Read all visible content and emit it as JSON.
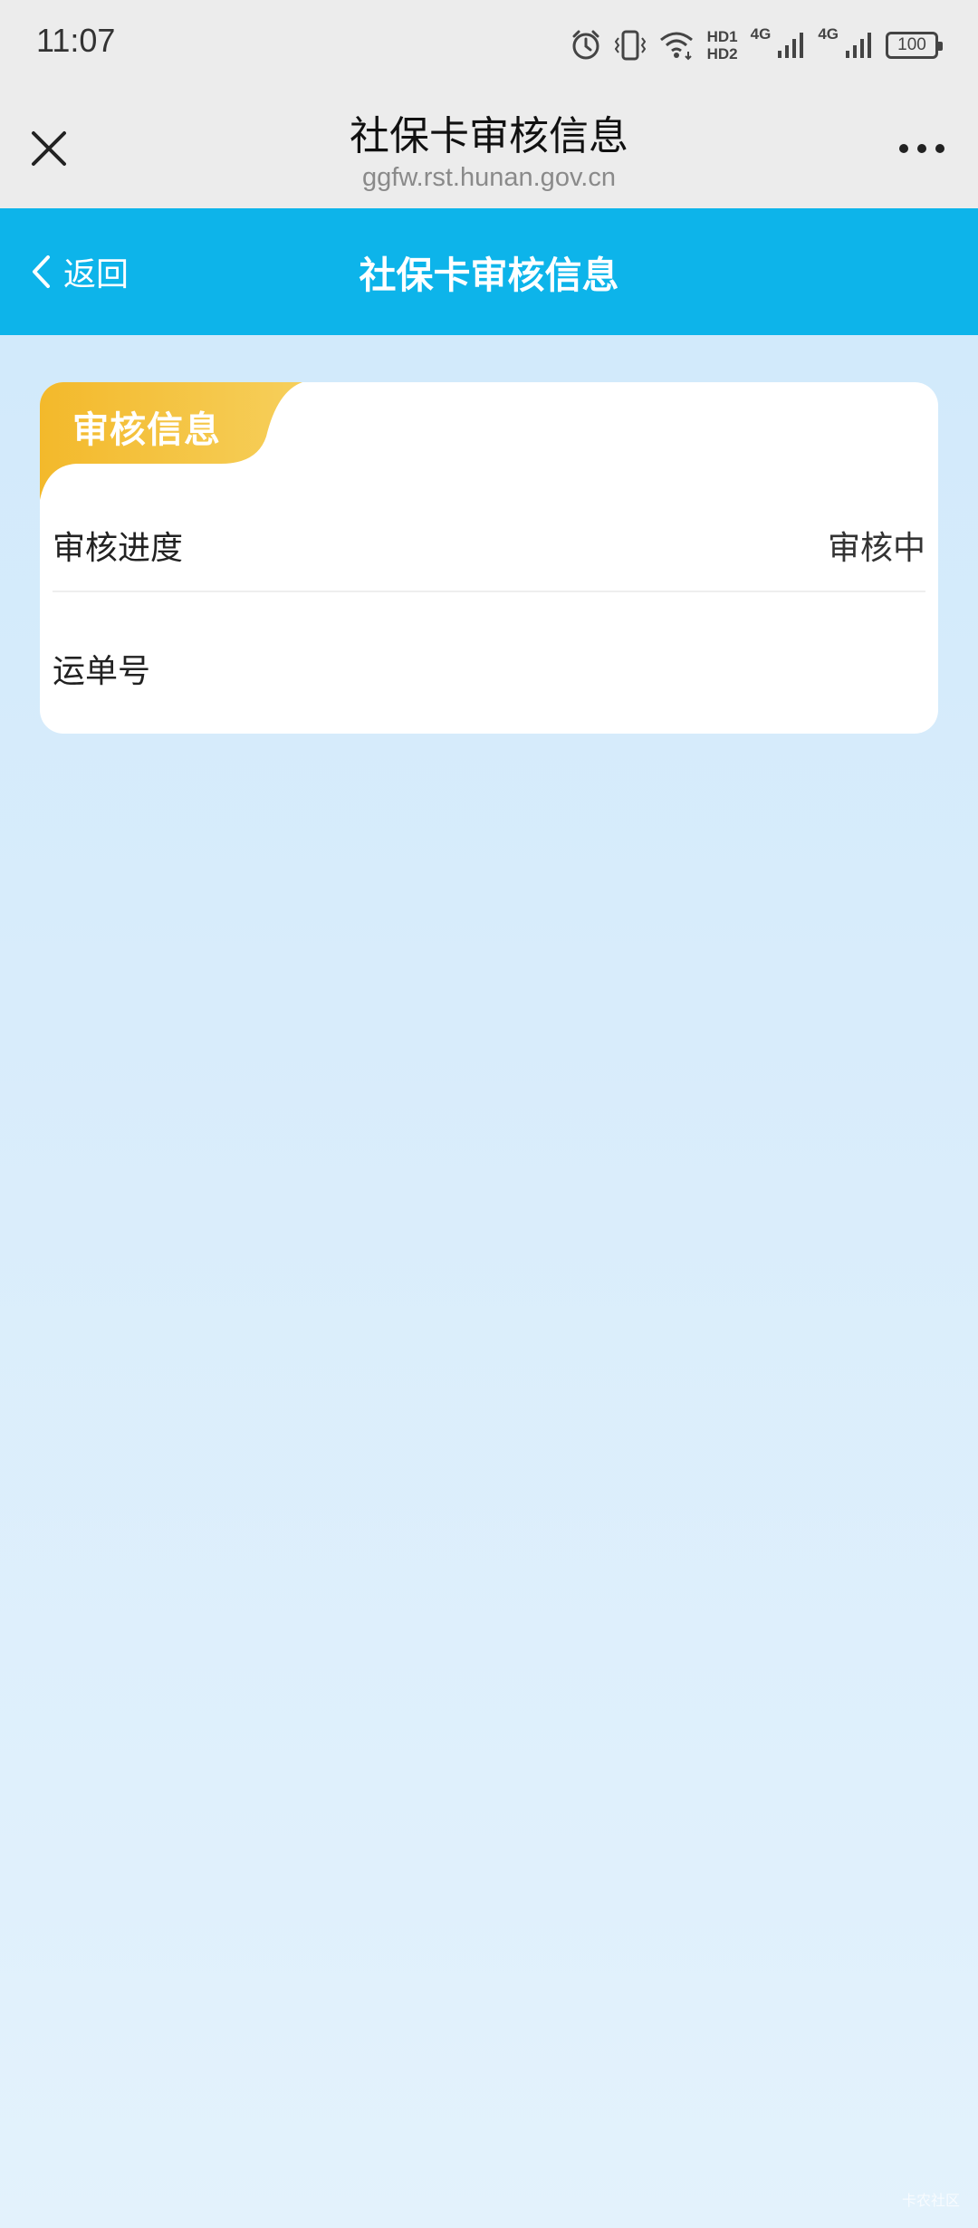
{
  "status_bar": {
    "time": "11:07",
    "hd_top": "HD1",
    "hd_bottom": "HD2",
    "net_1": "4G",
    "net_2": "4G",
    "battery": "100",
    "icons": [
      "alarm-icon",
      "vibrate-icon",
      "wifi-icon",
      "signal-icon",
      "signal-icon",
      "battery-icon"
    ]
  },
  "browser": {
    "title": "社保卡审核信息",
    "url": "ggfw.rst.hunan.gov.cn",
    "close_icon": "close-icon",
    "more_icon": "more-icon"
  },
  "header": {
    "back_label": "返回",
    "title": "社保卡审核信息",
    "color": "#0db4ea"
  },
  "card": {
    "tag": "审核信息",
    "tag_color": "#f3b92b",
    "rows": [
      {
        "label": "审核进度",
        "value": "审核中"
      },
      {
        "label": "运单号",
        "value": ""
      }
    ]
  },
  "watermark": "卡农社区"
}
